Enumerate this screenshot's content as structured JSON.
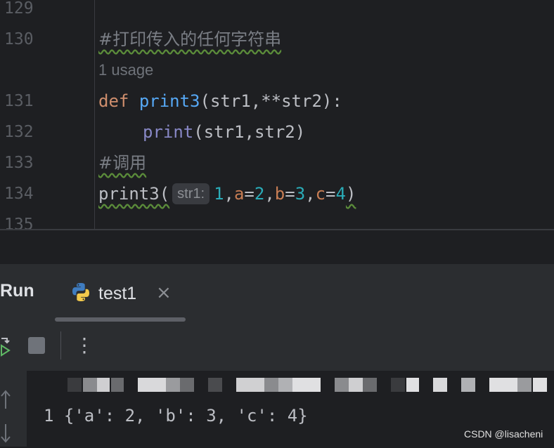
{
  "editor": {
    "lines": [
      {
        "number": "129",
        "type": "blank"
      },
      {
        "number": "130",
        "type": "comment",
        "text": "#打印传入的任何字符串"
      },
      {
        "number": "",
        "type": "usage",
        "text": "1 usage"
      },
      {
        "number": "131",
        "type": "def"
      },
      {
        "number": "132",
        "type": "print"
      },
      {
        "number": "133",
        "type": "comment",
        "text": "#调用"
      },
      {
        "number": "134",
        "type": "call"
      },
      {
        "number": "135",
        "type": "blank"
      }
    ],
    "def_line": {
      "keyword": "def",
      "name": "print3",
      "args": "(str1,**str2):"
    },
    "print_line": {
      "name": "print",
      "args": "(str1,str2)"
    },
    "call_line": {
      "name": "print3(",
      "hint": "str1:",
      "arg1": "1",
      "comma1": ",",
      "kwa": "a",
      "eq1": "=",
      "va": "2",
      "comma2": ",",
      "kwb": "b",
      "eq2": "=",
      "vb": "3",
      "comma3": ",",
      "kwc": "c",
      "eq3": "=",
      "vc": "4",
      "close": ")"
    }
  },
  "run_panel": {
    "title": "Run",
    "tab_label": "test1",
    "tab_icon": "python-icon",
    "close_glyph": "×",
    "more_glyph": "⋮"
  },
  "console": {
    "output": "1 {'a': 2, 'b': 3, 'c': 4}"
  },
  "watermark": "CSDN @lisacheni",
  "colors": {
    "keyword": "#cf8e6d",
    "function": "#56a8f5",
    "builtin": "#8888c6",
    "number": "#2aacb8",
    "param": "#c77d54",
    "comment": "#7a7e85"
  }
}
